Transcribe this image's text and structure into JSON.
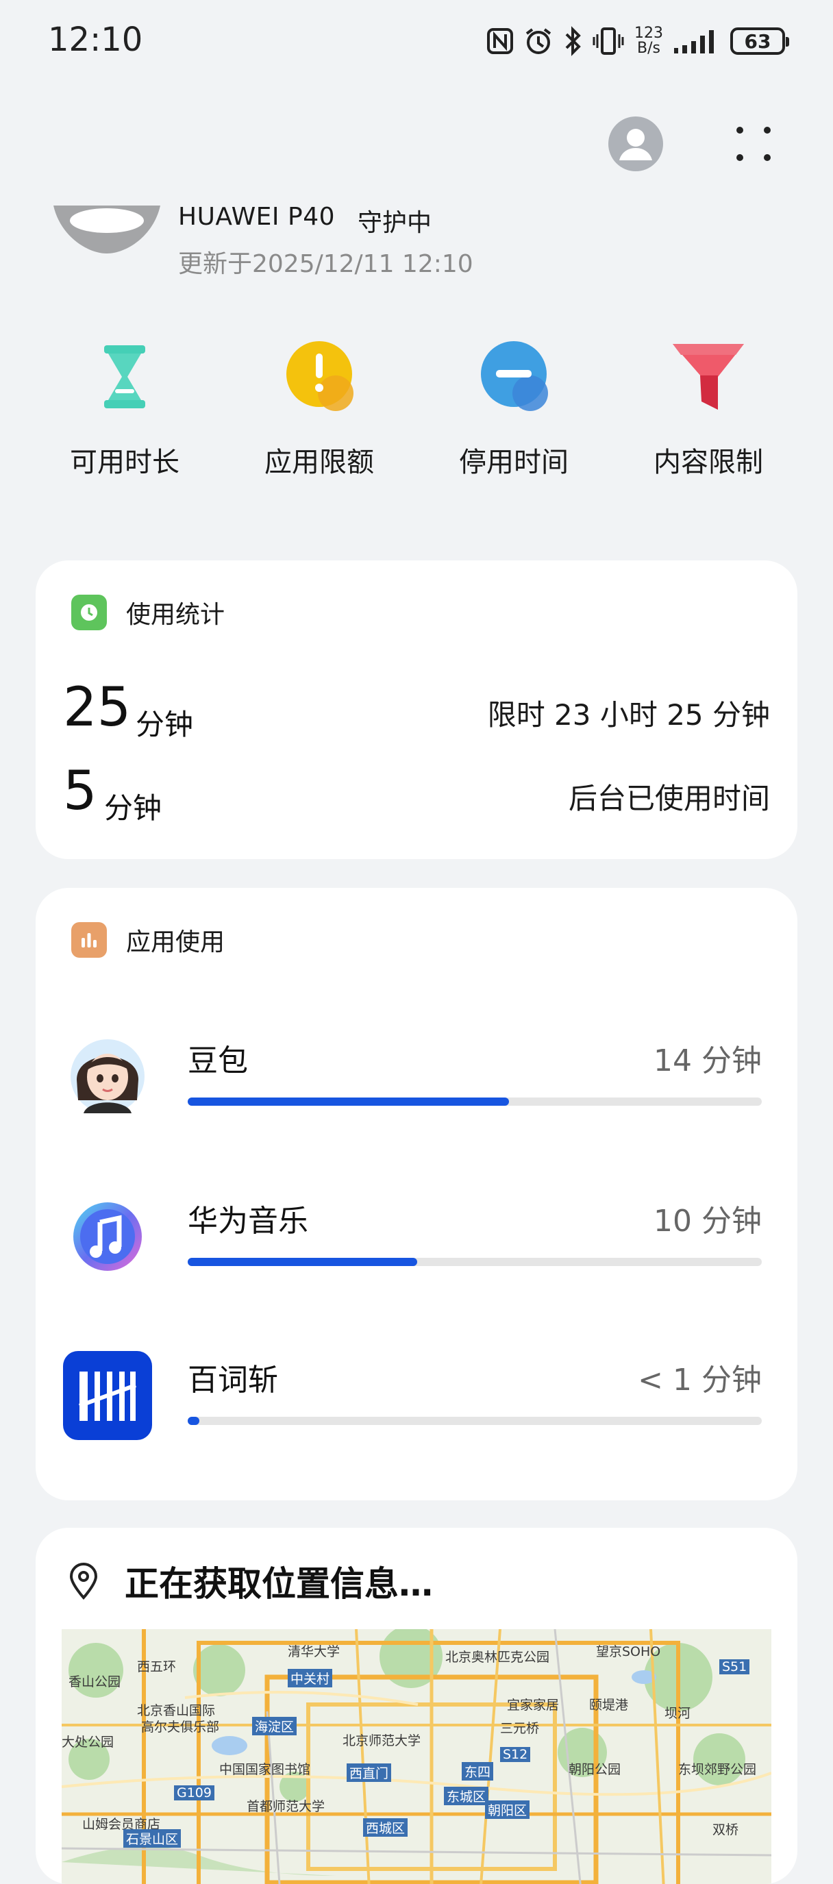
{
  "status_bar": {
    "time": "12:10",
    "net_speed_top": "123",
    "net_speed_bottom": "B/s",
    "battery": "63"
  },
  "device": {
    "name": "HUAWEI P40",
    "status": "守护中",
    "updated": "更新于2025/12/11 12:10"
  },
  "features": [
    {
      "label": "可用时长",
      "icon": "hourglass-icon",
      "color": "#45cfb6"
    },
    {
      "label": "应用限额",
      "icon": "app-limit-icon",
      "color": "#f4c20d"
    },
    {
      "label": "停用时间",
      "icon": "downtime-icon",
      "color": "#3a9be0"
    },
    {
      "label": "内容限制",
      "icon": "content-filter-icon",
      "color": "#e8404f"
    }
  ],
  "usage_stats": {
    "title": "使用统计",
    "total_value": "25",
    "total_unit": "分钟",
    "limit_text": "限时 23 小时 25 分钟",
    "background_value": "5",
    "background_unit": "分钟",
    "background_label": "后台已使用时间",
    "accent": "#5ec45c"
  },
  "app_usage": {
    "title": "应用使用",
    "accent": "#e8a069",
    "apps": [
      {
        "name": "豆包",
        "time": "14 分钟",
        "progress": 0.56
      },
      {
        "name": "华为音乐",
        "time": "10 分钟",
        "progress": 0.4
      },
      {
        "name": "百词斩",
        "time": "< 1 分钟",
        "progress": 0.02
      }
    ]
  },
  "location": {
    "title": "正在获取位置信息…",
    "map_labels": [
      "清华大学",
      "北京奥林匹克公园",
      "望京SOHO",
      "香山公园",
      "中关村",
      "西五环",
      "宜家家居",
      "颐堤港",
      "北京香山国际",
      "海淀区",
      "北京师范大学",
      "三元桥",
      "坝河",
      "S51",
      "高尔夫俱乐部",
      "大处公园",
      "中国国家图书馆",
      "朝阳公园",
      "东坝郊野公园",
      "西直门",
      "东四",
      "S12",
      "首都师范大学",
      "东城区",
      "朝阳区",
      "G109",
      "山姆会员商店",
      "石景山区",
      "西城区",
      "双桥"
    ]
  }
}
